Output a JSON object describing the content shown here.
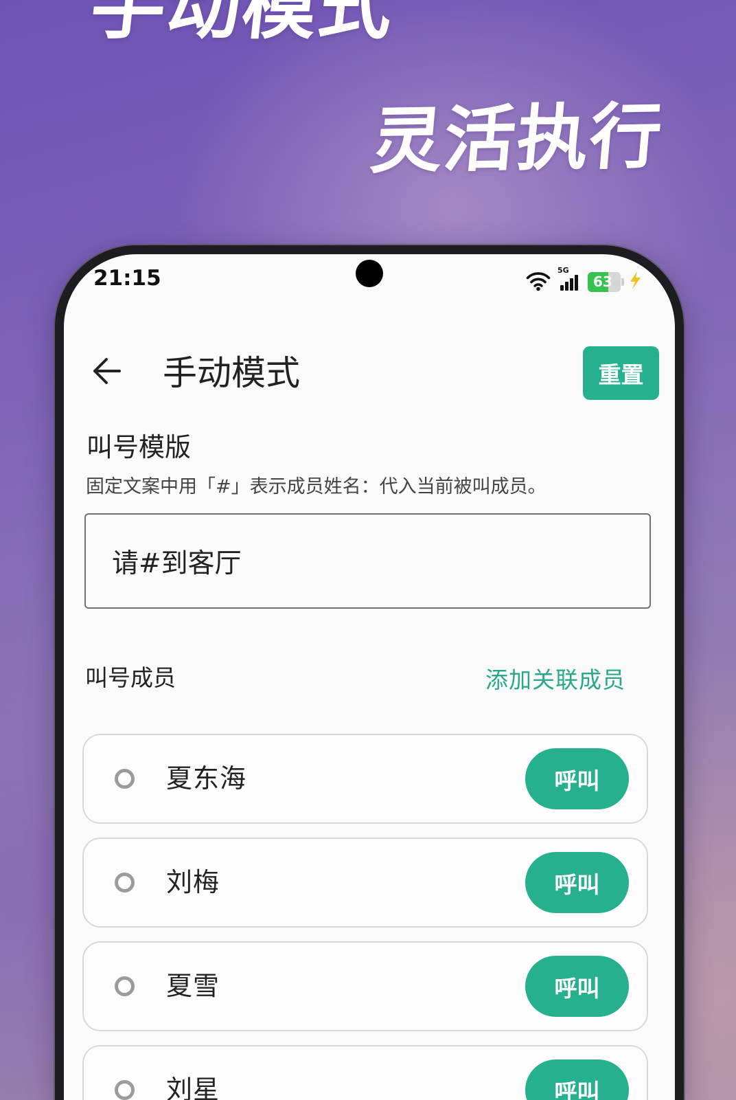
{
  "promo": {
    "headline": "手动模式",
    "subheadline": "灵活执行"
  },
  "status_bar": {
    "time": "21:15",
    "network": "5G",
    "battery_level": "63",
    "icons": [
      "wifi-icon",
      "signal-icon",
      "battery-icon",
      "charging-icon"
    ]
  },
  "app_bar": {
    "back_icon": "back-arrow-icon",
    "title": "手动模式",
    "reset_label": "重置"
  },
  "template": {
    "heading": "叫号模版",
    "description": "固定文案中用「#」表示成员姓名：代入当前被叫成员。",
    "value": "请#到客厅"
  },
  "members": {
    "heading": "叫号成员",
    "add_link": "添加关联成员",
    "items": [
      {
        "name": "夏东海",
        "call_label": "呼叫",
        "selected": false
      },
      {
        "name": "刘梅",
        "call_label": "呼叫",
        "selected": false
      },
      {
        "name": "夏雪",
        "call_label": "呼叫",
        "selected": false
      },
      {
        "name": "刘星",
        "call_label": "呼叫",
        "selected": false
      }
    ]
  },
  "colors": {
    "accent": "#27b08d",
    "link": "#2aa889",
    "battery": "#35c24f",
    "bolt": "#f1c21b"
  }
}
